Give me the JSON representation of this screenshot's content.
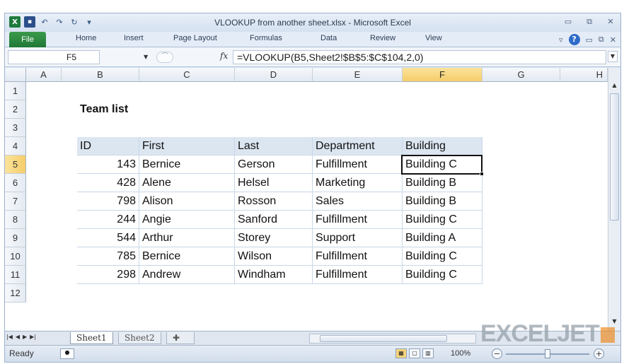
{
  "window": {
    "title": "VLOOKUP from another sheet.xlsx - Microsoft Excel"
  },
  "ribbon": {
    "tabs": [
      "File",
      "Home",
      "Insert",
      "Page Layout",
      "Formulas",
      "Data",
      "Review",
      "View"
    ]
  },
  "formula_bar": {
    "name_box": "F5",
    "fx_label": "fx",
    "formula": "=VLOOKUP(B5,Sheet2!$B$5:$C$104,2,0)"
  },
  "grid": {
    "columns": [
      "A",
      "B",
      "C",
      "D",
      "E",
      "F",
      "G",
      "H"
    ],
    "rows": [
      "1",
      "2",
      "3",
      "4",
      "5",
      "6",
      "7",
      "8",
      "9",
      "10",
      "11",
      "12"
    ],
    "selected_cell": "F5",
    "title_cell": "Team list",
    "table_headers": [
      "ID",
      "First",
      "Last",
      "Department",
      "Building"
    ],
    "table_rows": [
      [
        "143",
        "Bernice",
        "Gerson",
        "Fulfillment",
        "Building C"
      ],
      [
        "428",
        "Alene",
        "Helsel",
        "Marketing",
        "Building B"
      ],
      [
        "798",
        "Alison",
        "Rosson",
        "Sales",
        "Building B"
      ],
      [
        "244",
        "Angie",
        "Sanford",
        "Fulfillment",
        "Building C"
      ],
      [
        "544",
        "Arthur",
        "Storey",
        "Support",
        "Building A"
      ],
      [
        "785",
        "Bernice",
        "Wilson",
        "Fulfillment",
        "Building C"
      ],
      [
        "298",
        "Andrew",
        "Windham",
        "Fulfillment",
        "Building C"
      ]
    ]
  },
  "sheet_tabs": [
    "Sheet1",
    "Sheet2"
  ],
  "active_sheet": "Sheet1",
  "status_bar": {
    "ready": "Ready",
    "zoom": "100%"
  },
  "watermark": "EXCELJET",
  "colors": {
    "file_tab": "#207937",
    "selected_header": "#f5cd6a",
    "table_header_fill": "#dce6f1"
  }
}
